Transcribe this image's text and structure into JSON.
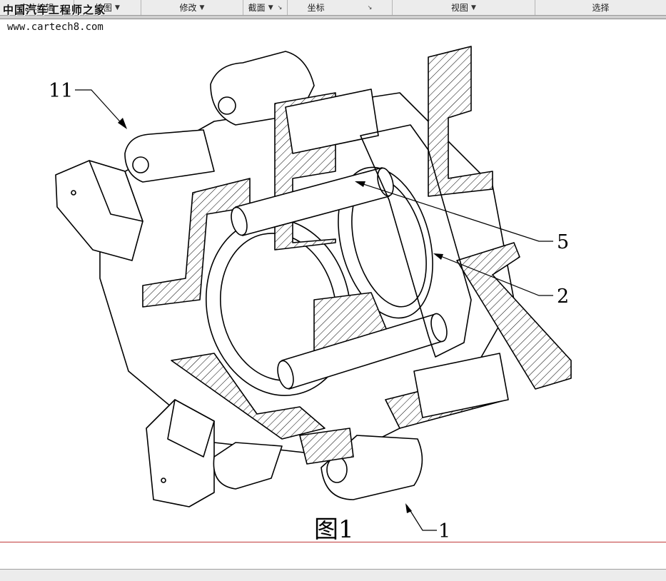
{
  "toolbar": {
    "groups": [
      {
        "label": "实体编辑",
        "arrow": ""
      },
      {
        "label": "绘图",
        "arrow": "▼"
      },
      {
        "label": "修改",
        "arrow": "▼"
      },
      {
        "label": "截面",
        "arrow": "▼"
      },
      {
        "label": "坐标",
        "arrow": ""
      },
      {
        "label": "视图",
        "arrow": "▼"
      },
      {
        "label": "选择",
        "arrow": ""
      }
    ]
  },
  "watermark": {
    "line1": "中国汽车工程师之家",
    "line2": "www.cartech8.com"
  },
  "figure": {
    "caption": "图1",
    "callouts": {
      "c11": "11",
      "c5": "5",
      "c2": "2",
      "c1": "1"
    }
  }
}
